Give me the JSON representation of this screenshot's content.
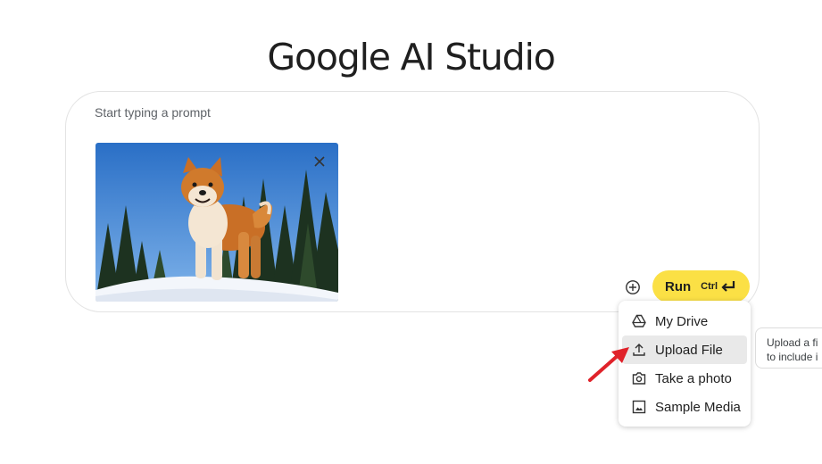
{
  "brand": {
    "title": "Google AI Studio"
  },
  "prompt": {
    "placeholder": "Start typing a prompt",
    "value": ""
  },
  "attachment": {
    "close_icon": "close-icon"
  },
  "actions": {
    "add_icon": "add-circle-icon",
    "run_label": "Run",
    "run_shortcut": "Ctrl",
    "run_color": "#fbe045"
  },
  "menu": {
    "items": [
      {
        "label": "My Drive",
        "icon": "drive-icon"
      },
      {
        "label": "Upload File",
        "icon": "upload-icon",
        "highlighted": true
      },
      {
        "label": "Take a photo",
        "icon": "camera-icon"
      },
      {
        "label": "Sample Media",
        "icon": "image-icon"
      }
    ]
  },
  "tooltip": {
    "line1": "Upload a fi",
    "line2": "to include i"
  },
  "annotation": {
    "arrow_color": "#e0222a"
  }
}
